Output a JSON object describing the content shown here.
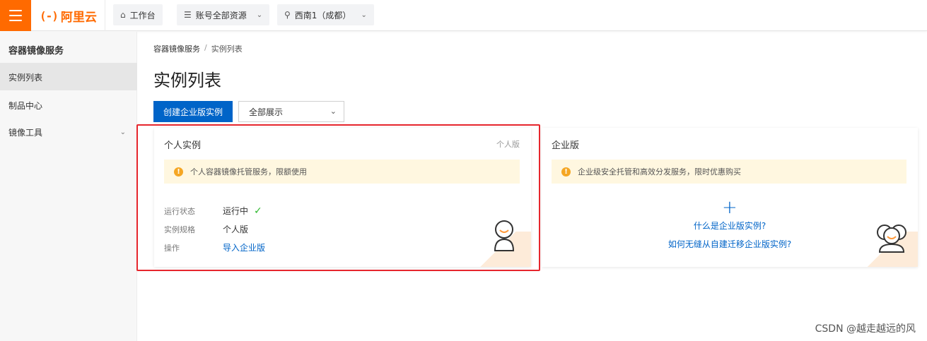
{
  "topbar": {
    "logo_mark": "(-)",
    "logo_text": "阿里云",
    "workbench": "工作台",
    "resources": "账号全部资源",
    "region": "西南1（成都）"
  },
  "sidebar": {
    "title": "容器镜像服务",
    "items": [
      {
        "label": "实例列表",
        "active": true
      },
      {
        "label": "制品中心",
        "active": false
      },
      {
        "label": "镜像工具",
        "active": false
      }
    ]
  },
  "breadcrumb": {
    "root": "容器镜像服务",
    "separator": "/",
    "current": "实例列表"
  },
  "page": {
    "title": "实例列表",
    "create_button": "创建企业版实例",
    "filter_value": "全部展示"
  },
  "personal_card": {
    "title": "个人实例",
    "tag": "个人版",
    "notice": "个人容器镜像托管服务，限额使用",
    "status_label": "运行状态",
    "status_value": "运行中",
    "spec_label": "实例规格",
    "spec_value": "个人版",
    "action_label": "操作",
    "action_link": "导入企业版"
  },
  "enterprise_card": {
    "title": "企业版",
    "notice": "企业级安全托管和高效分发服务，限时优惠购买",
    "plus": "+",
    "link1": "什么是企业版实例?",
    "link2": "如何无缝从自建迁移企业版实例?"
  },
  "watermark": "CSDN @越走越远的风",
  "colors": {
    "brand": "#ff6a00",
    "primary": "#0064c8",
    "highlight": "#e6262d",
    "success": "#2eb82e",
    "warning": "#f5a623"
  }
}
